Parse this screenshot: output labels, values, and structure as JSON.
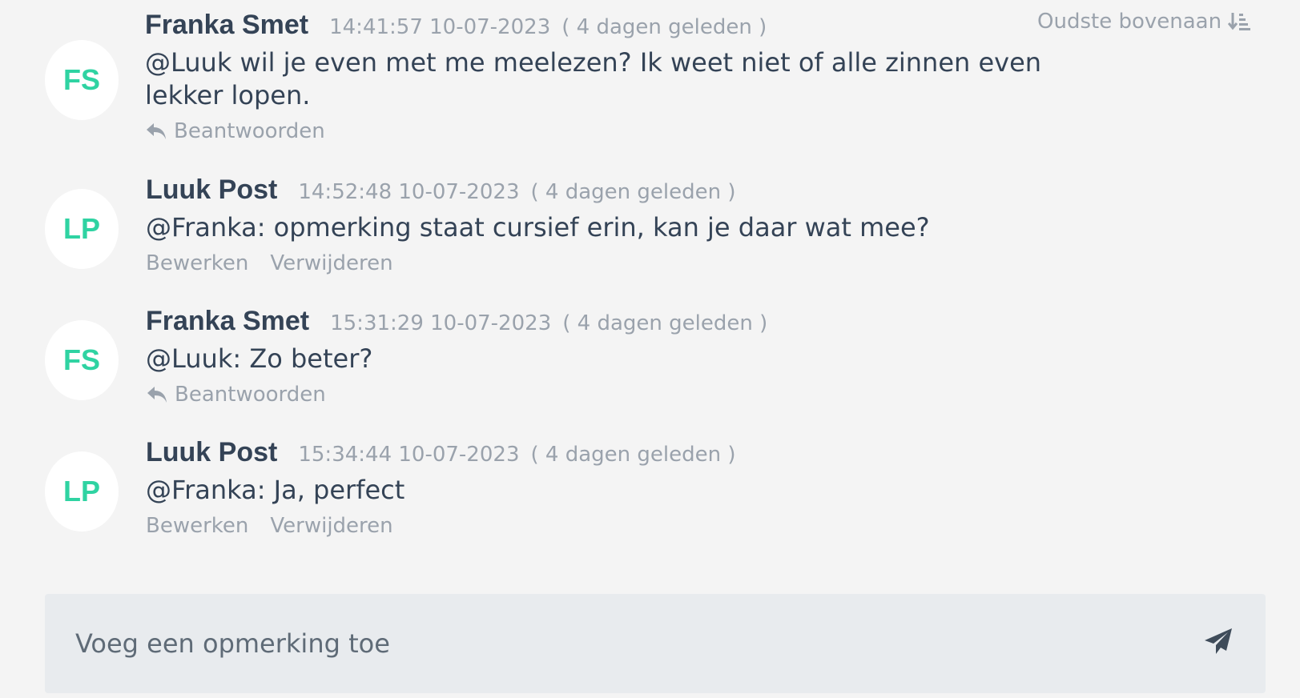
{
  "sort": {
    "label": "Oudste bovenaan",
    "icon": "sort-ascending-icon"
  },
  "comments": [
    {
      "initials": "FS",
      "author": "Franka Smet",
      "time": "14:41:57 10-07-2023",
      "relative": "( 4 dagen geleden )",
      "text": "@Luuk wil je even met me meelezen? Ik weet niet of alle zinnen even lekker lopen.",
      "actions": [
        "Beantwoorden"
      ]
    },
    {
      "initials": "LP",
      "author": "Luuk Post",
      "time": "14:52:48 10-07-2023",
      "relative": "( 4 dagen geleden )",
      "text": "@Franka: opmerking staat cursief erin, kan je daar wat mee?",
      "actions": [
        "Bewerken",
        "Verwijderen"
      ]
    },
    {
      "initials": "FS",
      "author": "Franka Smet",
      "time": "15:31:29 10-07-2023",
      "relative": "( 4 dagen geleden )",
      "text": "@Luuk: Zo beter?",
      "actions": [
        "Beantwoorden"
      ]
    },
    {
      "initials": "LP",
      "author": "Luuk Post",
      "time": "15:34:44 10-07-2023",
      "relative": "( 4 dagen geleden )",
      "text": "@Franka: Ja, perfect",
      "actions": [
        "Bewerken",
        "Verwijderen"
      ]
    }
  ],
  "composer": {
    "placeholder": "Voeg een opmerking toe",
    "send_icon": "paper-plane-icon"
  },
  "colors": {
    "background": "#f4f4f4",
    "avatar_text": "#2fd3a2",
    "author": "#344356",
    "muted": "#9aa2ac",
    "composer_bg": "#e8ebee"
  }
}
